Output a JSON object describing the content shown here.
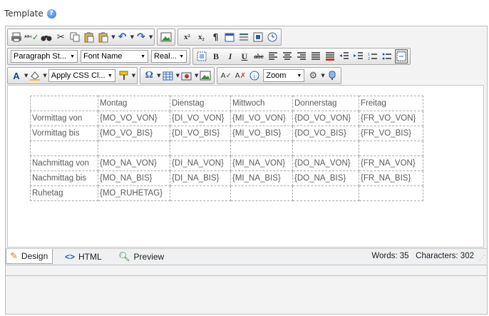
{
  "header": {
    "label": "Template",
    "help_icon": "help-circle-icon"
  },
  "toolbar": {
    "paragraph_style": "Paragraph St...",
    "font_name": "Font Name",
    "font_size": "Real...",
    "apply_css": "Apply CSS Cl...",
    "zoom": "Zoom",
    "superscript": "x²",
    "subscript": "x₂",
    "bold": "B",
    "italic": "I",
    "underline": "U",
    "strike": "abc",
    "font_color": "A",
    "omega": "Ω"
  },
  "table": {
    "headers": [
      "",
      "Montag",
      "Dienstag",
      "Mittwoch",
      "Donnerstag",
      "Freitag"
    ],
    "rows": [
      [
        "Vormittag von",
        "{MO_VO_VON}",
        "{DI_VO_VON}",
        "{MI_VO_VON}",
        "{DO_VO_VON}",
        "{FR_VO_VON}"
      ],
      [
        "Vormittag bis",
        "{MO_VO_BIS}",
        "{DI_VO_BIS}",
        "{MI_VO_BIS}",
        "{DO_VO_BIS}",
        "{FR_VO_BIS}"
      ],
      [
        "",
        "",
        "",
        "",
        "",
        ""
      ],
      [
        "Nachmittag von",
        "{MO_NA_VON}",
        "{DI_NA_VON}",
        "{MI_NA_VON}",
        "{DO_NA_VON}",
        "{FR_NA_VON}"
      ],
      [
        "Nachmittag bis",
        "{MO_NA_BIS}",
        "{DI_NA_BIS}",
        "{MI_NA_BIS}",
        "{DO_NA_BIS}",
        "{FR_NA_BIS}"
      ],
      [
        "Ruhetag",
        "{MO_RUHETAG}",
        "",
        "",
        "",
        ""
      ]
    ]
  },
  "modes": {
    "design": "Design",
    "html": "HTML",
    "preview": "Preview"
  },
  "status": {
    "words": "Words: 35",
    "characters": "Characters: 302"
  }
}
